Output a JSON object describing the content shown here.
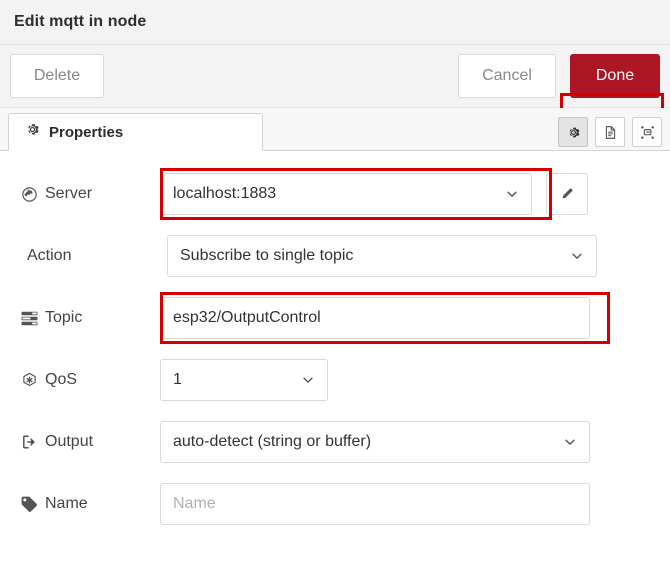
{
  "dialog": {
    "title": "Edit mqtt in node"
  },
  "actions": {
    "delete_label": "Delete",
    "cancel_label": "Cancel",
    "done_label": "Done",
    "done_color": "#ad1625",
    "annotation_color": "#d40000"
  },
  "tabs": [
    {
      "label": "Properties",
      "icon": "gear-icon",
      "active": true
    }
  ],
  "tab_tools": [
    {
      "name": "node-settings-icon",
      "active": true
    },
    {
      "name": "node-description-icon",
      "active": false
    },
    {
      "name": "node-appearance-icon",
      "active": false
    }
  ],
  "form": {
    "rows": [
      {
        "key": "server",
        "label": "Server",
        "icon": "globe-icon",
        "control": "select",
        "value": "localhost:1883",
        "has_edit_button": true,
        "edit_button_icon": "pencil-icon",
        "highlighted": true
      },
      {
        "key": "action",
        "label": "Action",
        "icon": null,
        "control": "select",
        "value": "Subscribe to single topic",
        "has_edit_button": false,
        "highlighted": false
      },
      {
        "key": "topic",
        "label": "Topic",
        "icon": "tasks-icon",
        "control": "input",
        "value": "esp32/OutputControl",
        "has_edit_button": false,
        "highlighted": true
      },
      {
        "key": "qos",
        "label": "QoS",
        "icon": "asterisk-hex-icon",
        "control": "select",
        "value": "1",
        "has_edit_button": false,
        "highlighted": false
      },
      {
        "key": "output",
        "label": "Output",
        "icon": "sign-out-icon",
        "control": "select",
        "value": "auto-detect (string or buffer)",
        "has_edit_button": false,
        "highlighted": false
      },
      {
        "key": "name",
        "label": "Name",
        "icon": "tag-icon",
        "control": "input",
        "value": "",
        "placeholder": "Name",
        "has_edit_button": false,
        "highlighted": false
      }
    ]
  }
}
